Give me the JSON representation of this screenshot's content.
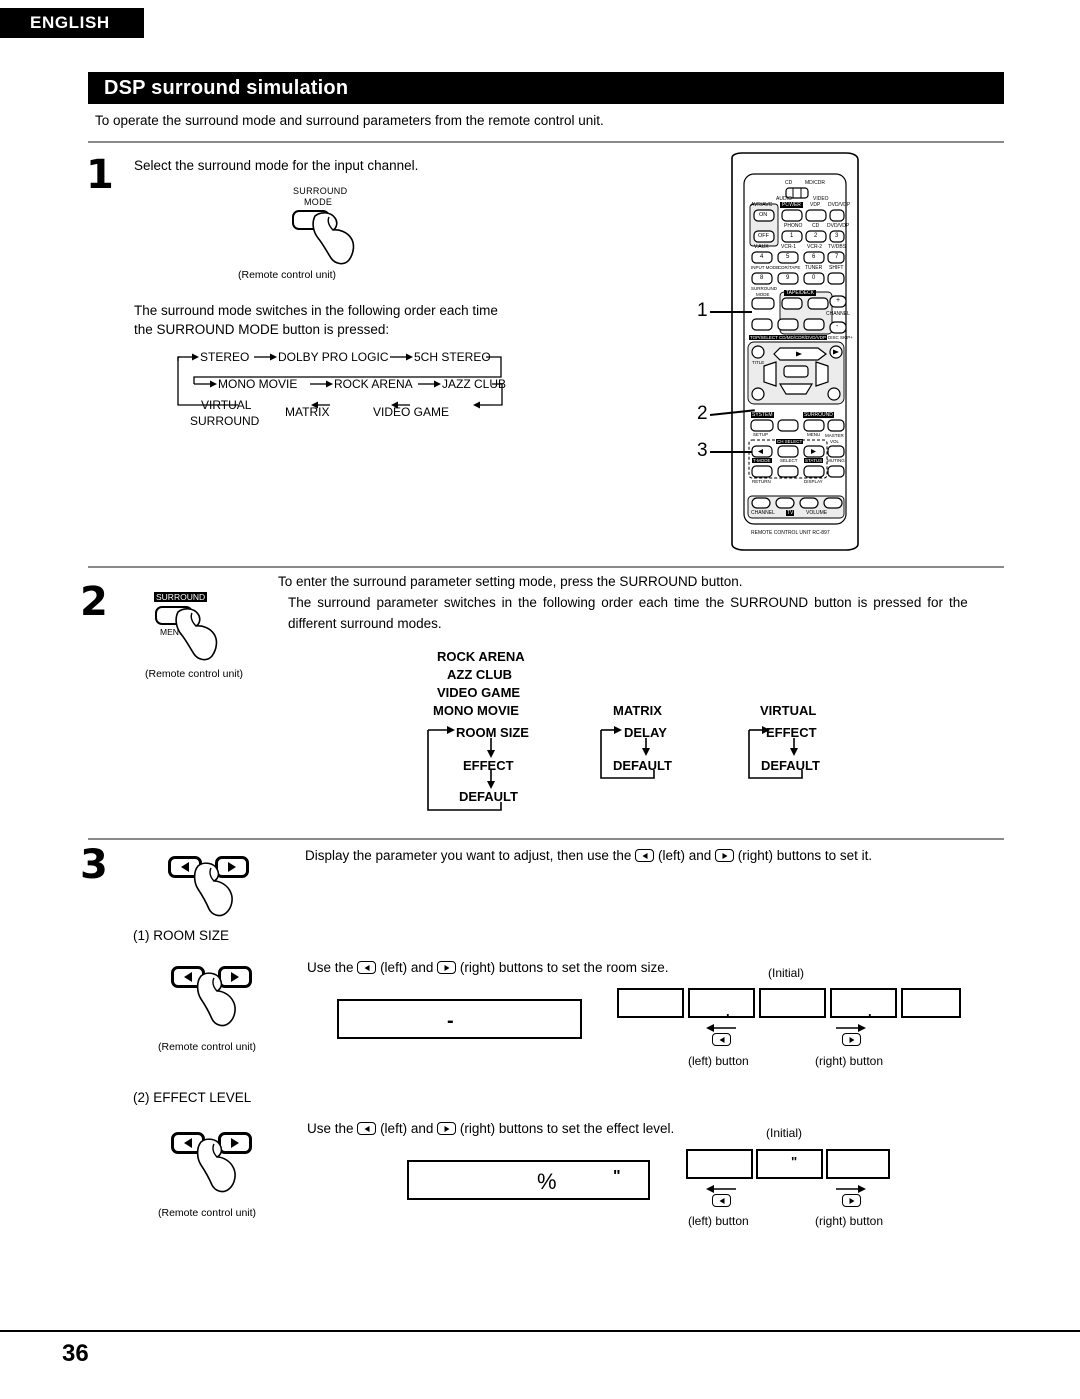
{
  "header": {
    "language_tab": "ENGLISH",
    "section_title": "DSP surround simulation",
    "intro": "To operate the surround mode and surround parameters from the remote control unit."
  },
  "page_number": "36",
  "steps": [
    {
      "number": "1",
      "instruction": "Select the surround mode for the input channel.",
      "button_label_line1": "SURROUND",
      "button_label_line2": "MODE",
      "caption": "(Remote control unit)",
      "body_line1": "The surround mode switches in the following order each time",
      "body_line2": "the SURROUND MODE button is pressed:"
    },
    {
      "number": "2",
      "button_label_top": "SURROUND",
      "button_label_bottom": "MENU",
      "caption": "(Remote control unit)",
      "body_line1": "To enter the surround parameter setting mode, press the SURROUND button.",
      "body_line2": "The surround parameter switches in the following order each time the SURROUND button is pressed for the",
      "body_line3": "different surround modes."
    },
    {
      "number": "3",
      "instruction_a": "Display the parameter you want to adjust, then use the",
      "instruction_left": "(left) and",
      "instruction_right": "(right) buttons to set it.",
      "sub_items": [
        {
          "label": "(1)  ROOM SIZE",
          "caption": "(Remote control unit)",
          "use_a": "Use the",
          "use_left": "(left) and",
          "use_right": "(right) buttons to set the room size.",
          "initial_label": "(Initial)",
          "left_button_label": "(left) button",
          "right_button_label": "(right) button",
          "display_value": "-",
          "segments": [
            "",
            ".",
            "",
            ".",
            ""
          ]
        },
        {
          "label": "(2)  EFFECT LEVEL",
          "caption": "(Remote control unit)",
          "use_a": "Use the",
          "use_left": "(left) and",
          "use_right": "(right) buttons to set the effect level.",
          "initial_label": "(Initial)",
          "left_button_label": "(left) button",
          "right_button_label": "(right) button",
          "display_value_percent": "%",
          "display_value_mark": "\"",
          "segments": [
            "",
            "\"",
            ""
          ]
        }
      ]
    }
  ],
  "surround_mode_cycle": {
    "row1": [
      "STEREO",
      "DOLBY PRO LOGIC",
      "5CH STEREO"
    ],
    "row2": [
      "MONO MOVIE",
      "ROCK ARENA",
      "JAZZ CLUB"
    ],
    "row3": [
      "VIRTUAL SURROUND",
      "MATRIX",
      "VIDEO GAME"
    ],
    "row3_virtual_line1": "VIRTUAL",
    "row3_virtual_line2": "SURROUND"
  },
  "parameter_flow": {
    "group_a": {
      "modes": [
        "ROCK ARENA",
        "AZZ CLUB",
        "VIDEO GAME",
        "MONO MOVIE"
      ],
      "params": [
        "ROOM SIZE",
        "EFFECT",
        "DEFAULT"
      ]
    },
    "group_b": {
      "modes": [
        "MATRIX"
      ],
      "params": [
        "DELAY",
        "DEFAULT"
      ]
    },
    "group_c": {
      "modes": [
        "VIRTUAL"
      ],
      "params": [
        "EFFECT",
        "DEFAULT"
      ]
    }
  },
  "remote": {
    "model_text": "REMOTE CONTROL UNIT RC-897",
    "callouts": [
      "1",
      "2",
      "3"
    ],
    "selector_labels": {
      "cd": "CD",
      "md_cdr": "MD/CDR",
      "audio": "AUDIO",
      "video": "VIDEO"
    },
    "power_label": "POWER",
    "power_rows": [
      {
        "group": "AVR/AVC",
        "on": "ON",
        "off": "OFF"
      }
    ],
    "source_row1": [
      "TV",
      "VDP",
      "DVD/VDP"
    ],
    "numeric_buttons": [
      {
        "label": "PHONO",
        "num": "1"
      },
      {
        "label": "CD",
        "num": "2"
      },
      {
        "label": "DVD/VDP",
        "num": "3"
      },
      {
        "label": "V.AUX",
        "num": "4"
      },
      {
        "label": "VCR-1",
        "num": "5"
      },
      {
        "label": "VCR-2",
        "num": "6"
      },
      {
        "label": "TV/DBS",
        "num": "7"
      },
      {
        "label": "INPUT MODE",
        "num": "8"
      },
      {
        "label": "CDR/TAPE",
        "num": "9"
      },
      {
        "label": "TUNER",
        "num": "0"
      }
    ],
    "shift_label": "SHIFT",
    "surround_mode_label_l1": "SURROUND",
    "surround_mode_label_l2": "MODE",
    "tape_deck_label": "TAPE/DECK",
    "channel_label": "CHANNEL",
    "channel_plus": "+",
    "channel_minus": "-",
    "top_select_label": "TOP/SELECT",
    "cd_md_label": "CD/MD/CDR/DVD/VDP",
    "disc_skip_label": "DISC SKIP+",
    "title_label": "TITLE",
    "system_label": "SYSTEM",
    "setup_label": "SETUP",
    "surround_label": "SURROUND",
    "menu_label": "MENU",
    "master_vol_label_l1": "MASTER",
    "master_vol_label_l2": "VOL",
    "ch_select_label": "CH SELECT",
    "select_label": "SELECT",
    "t_mode_label": "T-MODE",
    "return_label": "RETURN",
    "status_label": "STATUS",
    "display_label": "DISPLAY",
    "muting_label": "MUTING",
    "bottom_channel": "CHANNEL",
    "bottom_tv": "TV",
    "bottom_volume": "VOLUME"
  }
}
